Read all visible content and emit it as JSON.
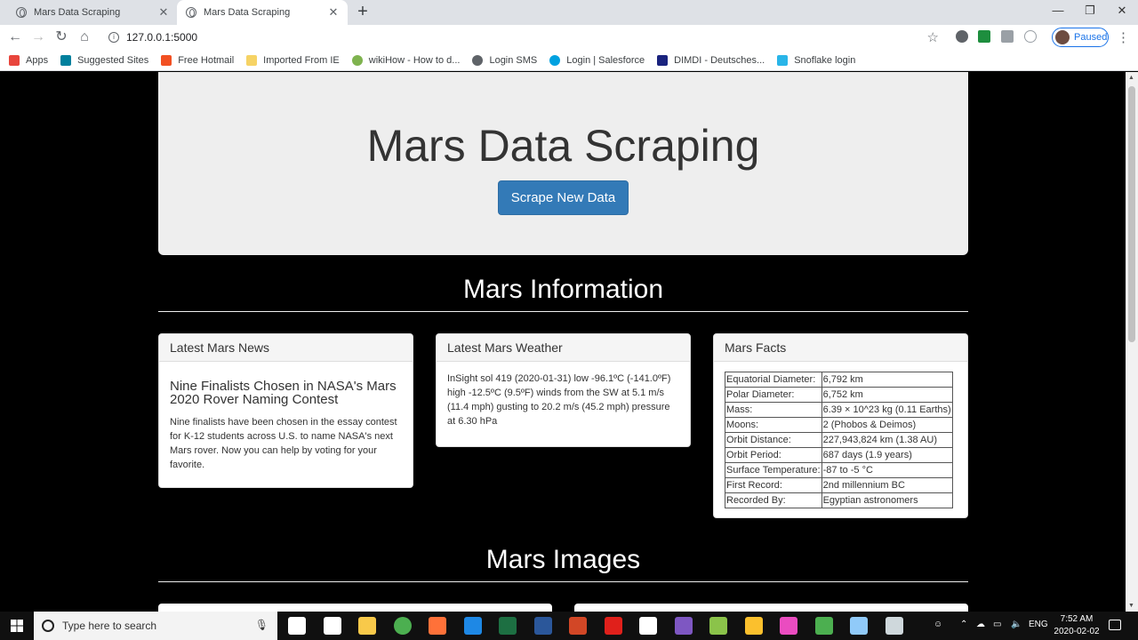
{
  "browser": {
    "tabs": [
      {
        "title": "Mars Data Scraping",
        "active": false
      },
      {
        "title": "Mars Data Scraping",
        "active": true
      }
    ],
    "url": "127.0.0.1:5000",
    "profile_label": "Paused",
    "bookmarks": [
      {
        "label": "Apps",
        "icon": "apps-grid-icon",
        "color": "#e8453c"
      },
      {
        "label": "Suggested Sites",
        "icon": "bing-icon",
        "color": "#00809d"
      },
      {
        "label": "Free Hotmail",
        "icon": "windows-logo-icon",
        "color": "#f25022"
      },
      {
        "label": "Imported From IE",
        "icon": "folder-icon",
        "color": "#f6d365"
      },
      {
        "label": "wikiHow - How to d...",
        "icon": "wikihow-icon",
        "color": "#7fb34f"
      },
      {
        "label": "Login SMS",
        "icon": "globe-icon",
        "color": "#5f6368"
      },
      {
        "label": "Login | Salesforce",
        "icon": "salesforce-cloud-icon",
        "color": "#00a1e0"
      },
      {
        "label": "DIMDI - Deutsches...",
        "icon": "dimdi-icon",
        "color": "#1a237e"
      },
      {
        "label": "Snoflake login",
        "icon": "snowflake-icon",
        "color": "#29b5e8"
      }
    ]
  },
  "page": {
    "header_title": "Mars Data Scraping",
    "scrape_button": "Scrape New Data",
    "info_section_title": "Mars Information",
    "news": {
      "heading": "Latest Mars News",
      "title": "Nine Finalists Chosen in NASA's Mars 2020 Rover Naming Contest",
      "body": "Nine finalists have been chosen in the essay contest for K-12 students across U.S. to name NASA's next Mars rover. Now you can help by voting for your favorite."
    },
    "weather": {
      "heading": "Latest Mars Weather",
      "body": "InSight sol 419 (2020-01-31) low -96.1ºC (-141.0ºF) high -12.5ºC (9.5ºF) winds from the SW at 5.1 m/s (11.4 mph) gusting to 20.2 m/s (45.2 mph) pressure at 6.30 hPa"
    },
    "facts": {
      "heading": "Mars Facts",
      "rows": [
        [
          "Equatorial Diameter:",
          "6,792 km"
        ],
        [
          "Polar Diameter:",
          "6,752 km"
        ],
        [
          "Mass:",
          "6.39 × 10^23 kg (0.11 Earths)"
        ],
        [
          "Moons:",
          "2 (Phobos & Deimos)"
        ],
        [
          "Orbit Distance:",
          "227,943,824 km (1.38 AU)"
        ],
        [
          "Orbit Period:",
          "687 days (1.9 years)"
        ],
        [
          "Surface Temperature:",
          "-87 to -5 °C"
        ],
        [
          "First Record:",
          "2nd millennium BC"
        ],
        [
          "Recorded By:",
          "Egyptian astronomers"
        ]
      ]
    },
    "images_section_title": "Mars Images"
  },
  "taskbar": {
    "search_placeholder": "Type here to search",
    "language": "ENG",
    "time": "7:52 AM",
    "date": "2020-02-02",
    "apps": [
      {
        "icon": "task-view-icon",
        "color": "#ffffff"
      },
      {
        "icon": "mail-icon",
        "color": "#ffffff"
      },
      {
        "icon": "file-explorer-icon",
        "color": "#f8c94a"
      },
      {
        "icon": "chrome-icon",
        "color": "#4caf50"
      },
      {
        "icon": "firefox-icon",
        "color": "#ff7139"
      },
      {
        "icon": "edge-icon",
        "color": "#1e88e5"
      },
      {
        "icon": "excel-icon",
        "color": "#1d6f42"
      },
      {
        "icon": "word-icon",
        "color": "#2b579a"
      },
      {
        "icon": "powerpoint-icon",
        "color": "#d24726"
      },
      {
        "icon": "acrobat-icon",
        "color": "#e0201b"
      },
      {
        "icon": "store-icon",
        "color": "#ffffff"
      },
      {
        "icon": "onenote-icon",
        "color": "#7e57c2"
      },
      {
        "icon": "notepad-icon",
        "color": "#8bc34a"
      },
      {
        "icon": "norton-icon",
        "color": "#fbc02d"
      },
      {
        "icon": "itunes-icon",
        "color": "#ea4cc0"
      },
      {
        "icon": "anaconda-icon",
        "color": "#4caf50"
      },
      {
        "icon": "app-icon",
        "color": "#90caf9"
      },
      {
        "icon": "terminal-icon",
        "color": "#cfd8dc"
      }
    ]
  }
}
